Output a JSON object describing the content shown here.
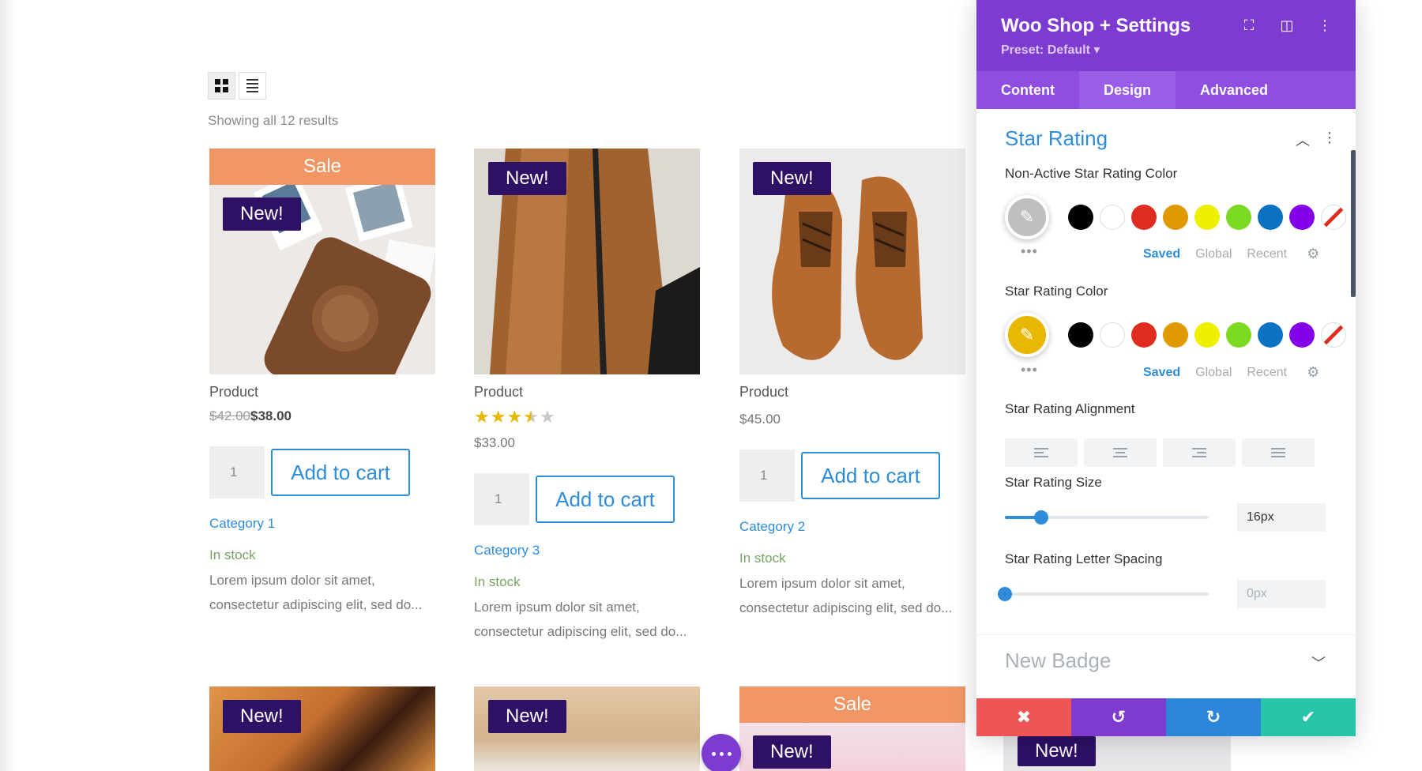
{
  "toolbar": {
    "grid_view_label": "grid view",
    "list_view_label": "list view"
  },
  "results_text": "Showing all 12 results",
  "products": [
    {
      "sale_label": "Sale",
      "new_label": "New!",
      "title": "Product",
      "price_old": "$42.00",
      "price": "$38.00",
      "qty": "1",
      "add_to_cart": "Add to cart",
      "category": "Category 1",
      "stock": "In stock",
      "desc_line1": "Lorem ipsum dolor sit amet,",
      "desc_line2": "consectetur adipiscing elit, sed do..."
    },
    {
      "new_label": "New!",
      "title": "Product",
      "rating": 3.5,
      "rating_max": 5,
      "price": "$33.00",
      "qty": "1",
      "add_to_cart": "Add to cart",
      "category": "Category 3",
      "stock": "In stock",
      "desc_line1": "Lorem ipsum dolor sit amet,",
      "desc_line2": "consectetur adipiscing elit, sed do..."
    },
    {
      "new_label": "New!",
      "title": "Product",
      "price": "$45.00",
      "qty": "1",
      "add_to_cart": "Add to cart",
      "category": "Category 2",
      "stock": "In stock",
      "desc_line1": "Lorem ipsum dolor sit amet,",
      "desc_line2": "consectetur adipiscing elit, sed do..."
    }
  ],
  "row2": [
    {
      "new_label": "New!"
    },
    {
      "new_label": "New!"
    },
    {
      "sale_label": "Sale",
      "new_label": "New!"
    },
    {
      "new_label": "New!"
    }
  ],
  "panel": {
    "title": "Woo Shop + Settings",
    "preset": "Preset: Default ▾",
    "tabs": [
      "Content",
      "Design",
      "Advanced"
    ],
    "active_tab": "Design",
    "section_title": "Star Rating",
    "non_active_label": "Non-Active Star Rating Color",
    "star_color_label": "Star Rating Color",
    "swatches": [
      "#000000",
      "#ffffff",
      "#e02b20",
      "#e09900",
      "#edf000",
      "#7cda24",
      "#0c71c3",
      "#8300e9"
    ],
    "color_tabs": [
      "Saved",
      "Global",
      "Recent"
    ],
    "alignment_label": "Star Rating Alignment",
    "size_label": "Star Rating Size",
    "size_value": "16px",
    "size_fraction": 0.18,
    "spacing_label": "Star Rating Letter Spacing",
    "spacing_value": "0px",
    "spacing_fraction": 0.0,
    "section2_title": "New Badge"
  },
  "colors": {
    "accent_purple": "#7e3bd0",
    "link_blue": "#2e8cd8",
    "sale_orange": "#f09765",
    "badge_navy": "#2e1065",
    "star_gold": "#e8b700",
    "cancel_red": "#ef5555",
    "undo_purple": "#7e3bd0",
    "redo_blue": "#2b87da",
    "save_green": "#29c4a9"
  }
}
